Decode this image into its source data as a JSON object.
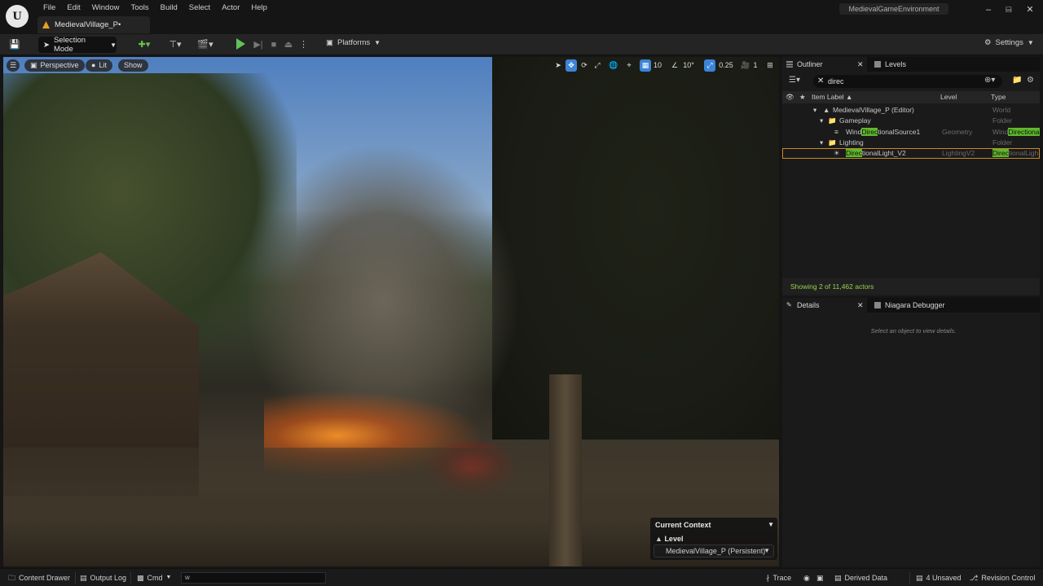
{
  "app": {
    "logo_text": "U",
    "project_name": "MedievalGameEnvironment",
    "level_tab": "MedievalVillage_P•"
  },
  "menu": [
    "File",
    "Edit",
    "Window",
    "Tools",
    "Build",
    "Select",
    "Actor",
    "Help"
  ],
  "toolbar": {
    "selection_mode": "Selection Mode",
    "platforms": "Platforms",
    "settings": "Settings"
  },
  "viewport": {
    "perspective": "Perspective",
    "lit": "Lit",
    "show": "Show",
    "grid_snap": "10",
    "angle_snap": "10°",
    "scale_snap": "0.25",
    "camera_speed": "1",
    "context": {
      "title": "Current Context",
      "level_label": "Level",
      "level_value": "MedievalVillage_P (Persistent)"
    }
  },
  "outliner": {
    "tab_outliner": "Outliner",
    "tab_levels": "Levels",
    "search_value": "direc",
    "columns": {
      "label": "Item Label ▲",
      "level": "Level",
      "type": "Type"
    },
    "rows": [
      {
        "label": "MedievalVillage_P (Editor)",
        "level": "",
        "type": "World"
      },
      {
        "label": "Gameplay",
        "level": "",
        "type": "Folder"
      },
      {
        "label_pre": "Wind",
        "label_hl": "Direc",
        "label_post": "tionalSource1",
        "level": "Geometry",
        "type_pre": "Wind",
        "type_hl": "Directiona"
      },
      {
        "label": "Lighting",
        "level": "",
        "type": "Folder"
      },
      {
        "label_hl": "Direc",
        "label_post": "tionalLight_V2",
        "level": "LightingV2",
        "type_hl": "Direc",
        "type_post": "tionalLigh"
      }
    ],
    "status": "Showing 2 of 11,462 actors"
  },
  "details": {
    "tab_details": "Details",
    "tab_niagara": "Niagara Debugger",
    "empty_message": "Select an object to view details."
  },
  "statusbar": {
    "content_drawer": "Content Drawer",
    "output_log": "Output Log",
    "cmd": "Cmd",
    "cmd_input": "w",
    "trace": "Trace",
    "derived_data": "Derived Data",
    "unsaved": "4 Unsaved",
    "revision_control": "Revision Control"
  },
  "colors": {
    "accent_blue": "#3b84d8",
    "search_highlight": "#5eb82c",
    "play_green": "#5fc25b",
    "selection_orange": "#c78a20"
  }
}
